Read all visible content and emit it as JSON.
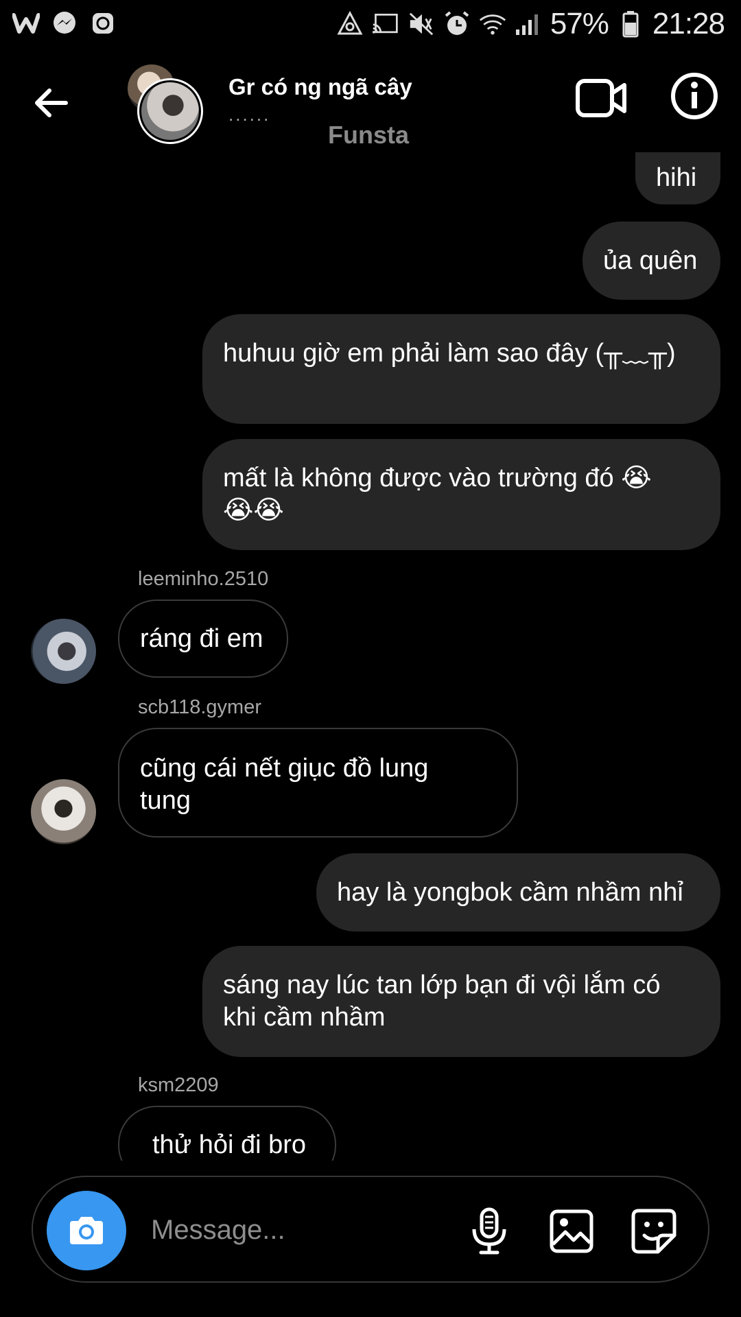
{
  "status_bar": {
    "battery_percent": "57%",
    "time": "21:28",
    "left_icons": [
      "wattpad-icon",
      "messenger-icon",
      "app-icon"
    ],
    "right_icons": [
      "recycle-icon",
      "cast-icon",
      "mute-icon",
      "alarm-icon",
      "wifi-icon",
      "signal-icon",
      "battery-icon"
    ]
  },
  "header": {
    "title": "Gr có ng ngã cây",
    "subtitle": "......",
    "account_label": "Funsta"
  },
  "messages": [
    {
      "type": "mine",
      "text": "hihi"
    },
    {
      "type": "mine",
      "text": "ủa quên"
    },
    {
      "type": "mine",
      "text": "huhuu giờ em phải làm sao đây (╥﹏╥)"
    },
    {
      "type": "mine",
      "text": "mất là không được vào trường đó 😭😭😭"
    },
    {
      "type": "theirs",
      "sender": "leeminho.2510",
      "text": "ráng đi em"
    },
    {
      "type": "theirs",
      "sender": "scb118.gymer",
      "text": "cũng cái nết giục đồ lung tung"
    },
    {
      "type": "mine",
      "text": "hay là yongbok cầm nhầm nhỉ"
    },
    {
      "type": "mine",
      "text": "sáng nay lúc tan lớp bạn đi vội lắm có khi cầm nhầm"
    },
    {
      "type": "theirs",
      "sender": "ksm2209",
      "text": "thử hỏi đi bro"
    }
  ],
  "composer": {
    "placeholder": "Message..."
  },
  "colors": {
    "background": "#000000",
    "my_bubble": "#262626",
    "their_bubble_border": "#3a3a3a",
    "camera_button": "#3897f0"
  }
}
